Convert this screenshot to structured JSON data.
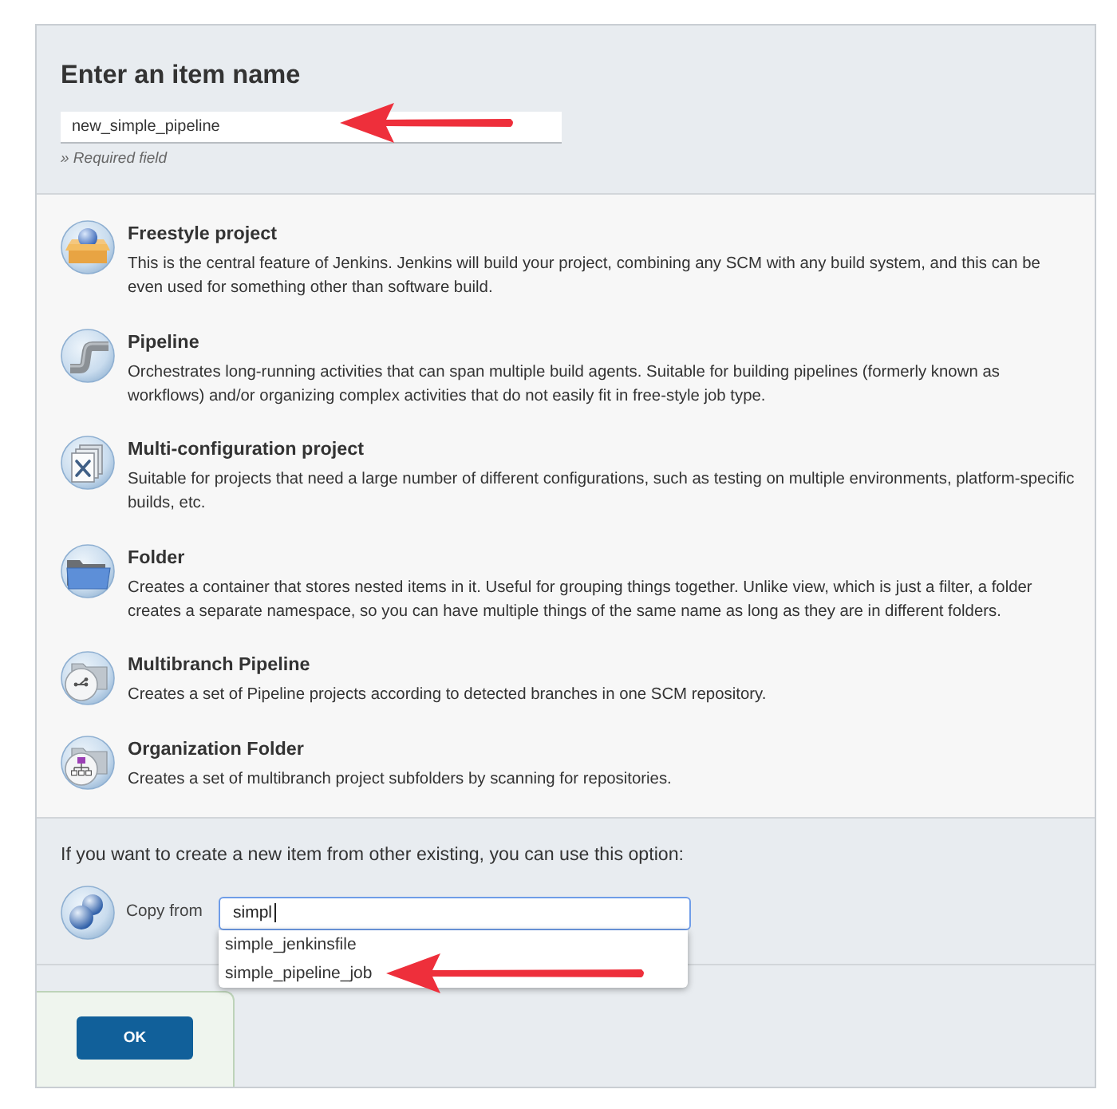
{
  "header": {
    "title": "Enter an item name",
    "name_field": {
      "value": "new_simple_pipeline",
      "annotated": true
    },
    "hint": "» Required field"
  },
  "item_types": [
    {
      "kind": "freestyle",
      "title": "Freestyle project",
      "description": "This is the central feature of Jenkins. Jenkins will build your project, combining any SCM with any build system, and this can be even used for something other than software build."
    },
    {
      "kind": "pipeline",
      "title": "Pipeline",
      "description": "Orchestrates long-running activities that can span multiple build agents. Suitable for building pipelines (formerly known as workflows) and/or organizing complex activities that do not easily fit in free-style job type."
    },
    {
      "kind": "multi_configuration",
      "title": "Multi-configuration project",
      "description": "Suitable for projects that need a large number of different configurations, such as testing on multiple environments, platform-specific builds, etc."
    },
    {
      "kind": "folder",
      "title": "Folder",
      "description": "Creates a container that stores nested items in it. Useful for grouping things together. Unlike view, which is just a filter, a folder creates a separate namespace, so you can have multiple things of the same name as long as they are in different folders."
    },
    {
      "kind": "multibranch",
      "title": "Multibranch Pipeline",
      "description": "Creates a set of Pipeline projects according to detected branches in one SCM repository."
    },
    {
      "kind": "organization_folder",
      "title": "Organization Folder",
      "description": "Creates a set of multibranch project subfolders by scanning for repositories."
    }
  ],
  "copy_section": {
    "prompt": "If you want to create a new item from other existing, you can use this option:",
    "label": "Copy from",
    "field": {
      "value": "simpl",
      "focused": true
    },
    "suggestions": [
      {
        "label": "simple_jenkinsfile",
        "annotated": false
      },
      {
        "label": "simple_pipeline_job",
        "annotated": true
      }
    ]
  },
  "ok_button": {
    "label": "OK"
  }
}
